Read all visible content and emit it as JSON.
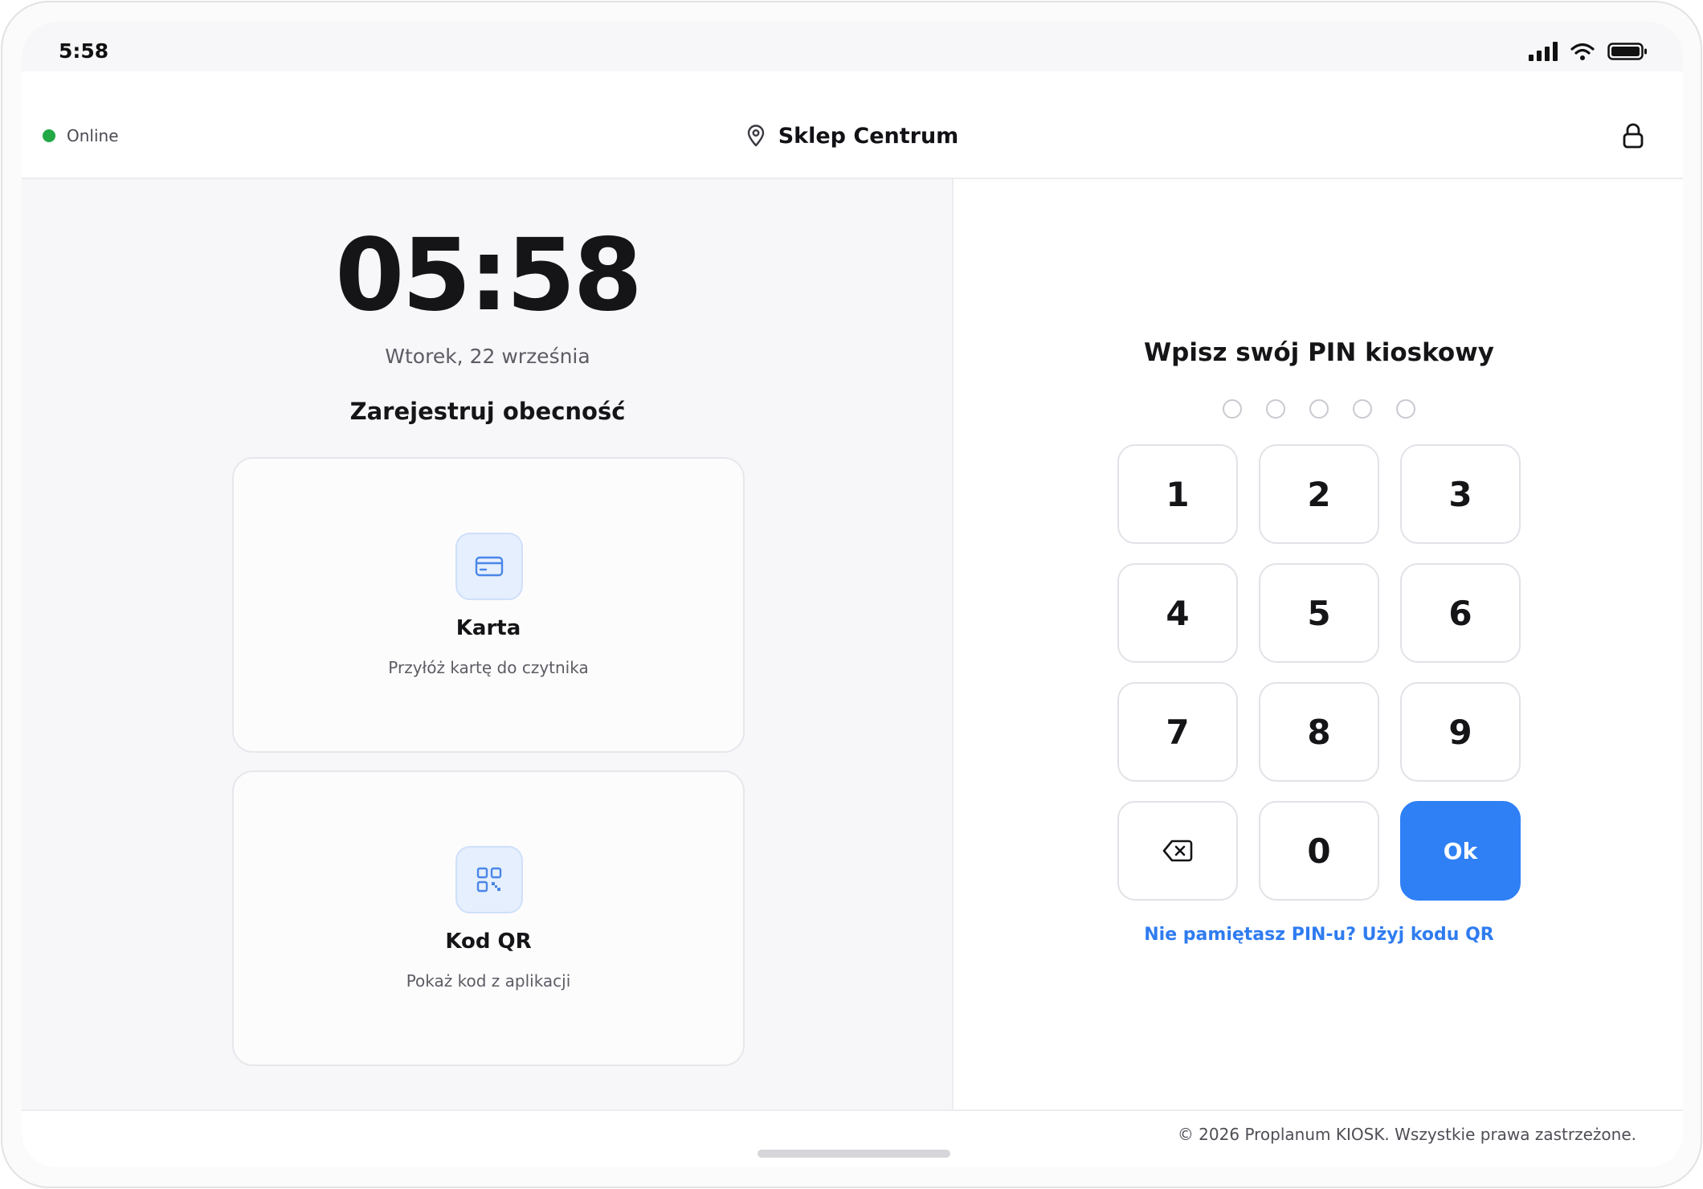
{
  "status_bar": {
    "time": "5:58"
  },
  "header": {
    "status_label": "Online",
    "status_color": "#22a845",
    "location": "Sklep Centrum",
    "location_icon": "map-pin-icon",
    "lock_icon": "lock-icon"
  },
  "attendance": {
    "clock": "05:58",
    "date": "Wtorek, 22 września",
    "heading": "Zarejestruj obecność",
    "options": [
      {
        "title": "Karta",
        "subtitle": "Przyłóż kartę do czytnika",
        "icon": "credit-card-icon"
      },
      {
        "title": "Kod QR",
        "subtitle": "Pokaż kod z aplikacji",
        "icon": "qr-code-icon"
      }
    ]
  },
  "pin": {
    "title": "Wpisz swój PIN kioskowy",
    "digits_entered": 0,
    "digits_total": 5,
    "keys": [
      "1",
      "2",
      "3",
      "4",
      "5",
      "6",
      "7",
      "8",
      "9",
      "",
      "0",
      "Ok"
    ],
    "backspace_icon": "backspace-icon",
    "ok_color": "#2f80f5",
    "forgot_link": "Nie pamiętasz PIN-u? Użyj kodu QR"
  },
  "footer": {
    "copyright": "© 2026 Proplanum KIOSK. Wszystkie prawa zastrzeżone."
  }
}
